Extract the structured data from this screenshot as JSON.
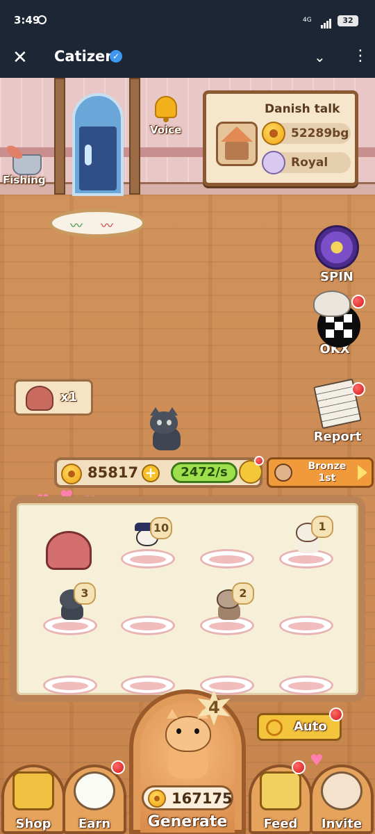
{
  "statusbar": {
    "time": "3:49",
    "network": "4G",
    "battery": "32"
  },
  "appbar": {
    "title": "Catizen"
  },
  "room": {
    "voice_label": "Voice",
    "fishing_label": "Fishing"
  },
  "sign": {
    "name": "Danish talk",
    "balance": "52289bg",
    "rank": "Royal"
  },
  "side": {
    "spin_label": "SPIN",
    "okx_label": "OKX",
    "report_label": "Report"
  },
  "food": {
    "count": "x1"
  },
  "stats": {
    "coins": "85817",
    "rate": "2472/s"
  },
  "league": {
    "tier": "Bronze",
    "position": "1st"
  },
  "board": {
    "levels": [
      "10",
      "1",
      "3",
      "2"
    ]
  },
  "generate": {
    "level": "4",
    "total": "167175",
    "label": "Generate"
  },
  "auto_label": "Auto",
  "nav": {
    "shop": "Shop",
    "earn": "Earn",
    "feed": "Feed",
    "invite": "Invite"
  },
  "colors": {
    "wood": "#c7844d",
    "board": "#f7f0d8",
    "accent": "#f3c43c",
    "rate_green": "#9ee04b"
  }
}
